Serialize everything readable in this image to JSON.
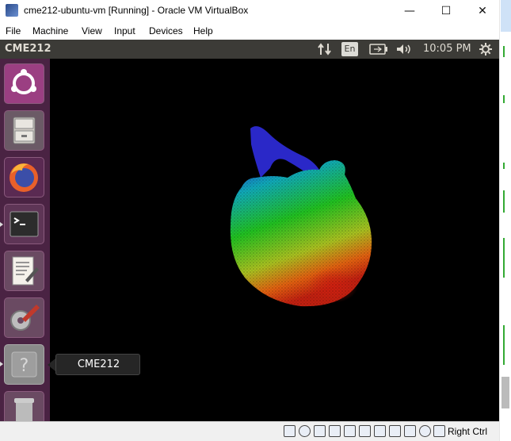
{
  "window": {
    "title": "cme212-ubuntu-vm [Running] - Oracle VM VirtualBox",
    "minimize_glyph": "—",
    "maximize_glyph": "☐",
    "close_glyph": "✕"
  },
  "menu": [
    "File",
    "Machine",
    "View",
    "Input",
    "Devices",
    "Help"
  ],
  "panel": {
    "title": "CME212",
    "language": "En",
    "time": "10:05 PM"
  },
  "launcher": {
    "items": [
      "Ubuntu Dash",
      "Files",
      "Firefox",
      "Terminal",
      "Text Editor",
      "System Settings",
      "Unknown Application",
      "Trash"
    ],
    "tooltip": "CME212"
  },
  "statusbar": {
    "host_key": "Right Ctrl"
  },
  "colors": {
    "panel_bg": "#3c3b37",
    "launcher_bg": "#4a2343",
    "desktop_bg": "#000000"
  }
}
